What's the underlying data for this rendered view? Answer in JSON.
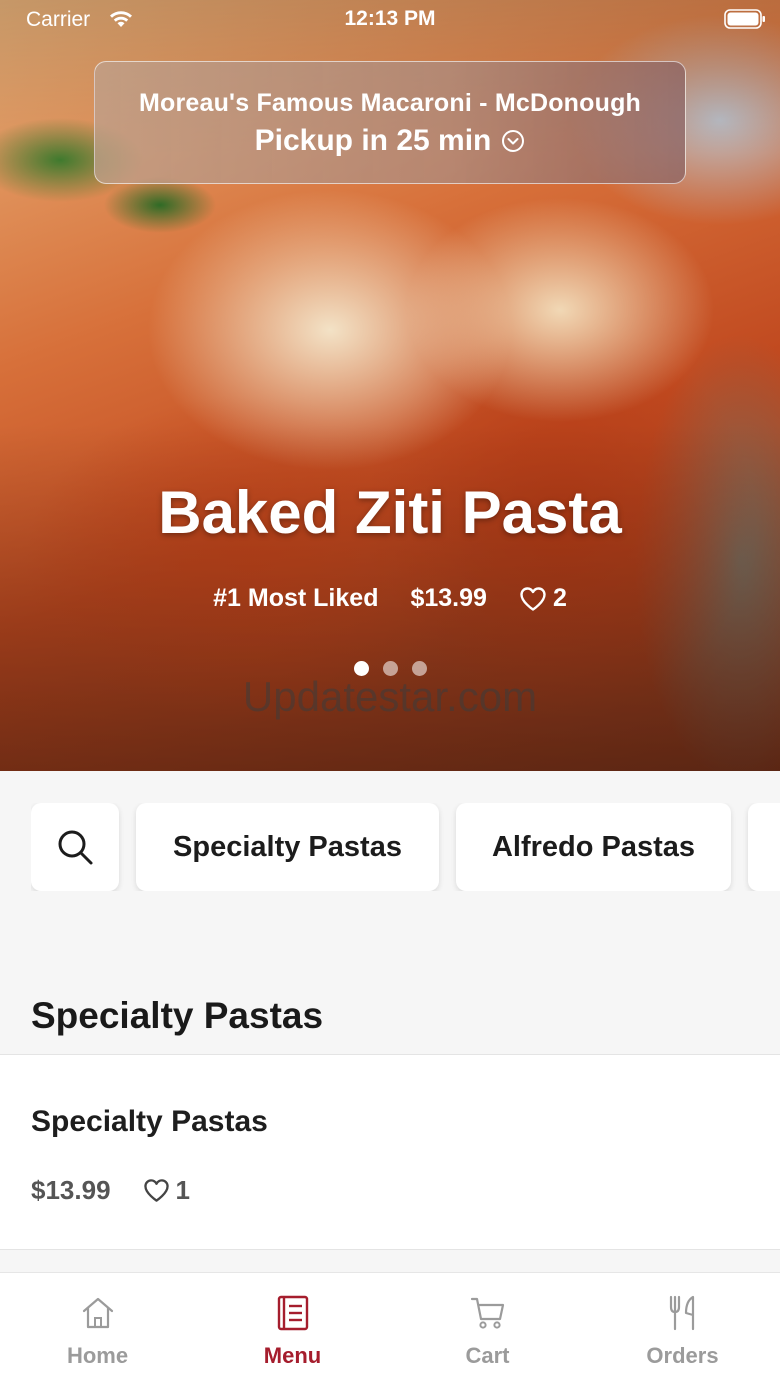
{
  "status_bar": {
    "carrier": "Carrier",
    "time": "12:13 PM"
  },
  "store": {
    "name": "Moreau's Famous Macaroni - McDonough",
    "pickup": "Pickup in 25 min"
  },
  "featured": {
    "title": "Baked Ziti Pasta",
    "tag": "#1 Most Liked",
    "price": "$13.99",
    "likes": "2",
    "watermark": "Updatestar.com",
    "active_slide": 1,
    "slide_count": 3
  },
  "categories": [
    {
      "label": "Specialty Pastas"
    },
    {
      "label": "Alfredo Pastas"
    },
    {
      "label": ""
    }
  ],
  "section": {
    "title": "Specialty Pastas"
  },
  "item": {
    "name": "Specialty Pastas",
    "price": "$13.99",
    "likes": "1"
  },
  "tabs": [
    {
      "label": "Home",
      "icon": "home-icon",
      "active": false
    },
    {
      "label": "Menu",
      "icon": "menu-icon",
      "active": true
    },
    {
      "label": "Cart",
      "icon": "cart-icon",
      "active": false
    },
    {
      "label": "Orders",
      "icon": "utensils-icon",
      "active": false
    }
  ],
  "colors": {
    "accent": "#a51d2d",
    "inactive_tab": "#9b9b9b",
    "background": "#f6f6f6"
  }
}
